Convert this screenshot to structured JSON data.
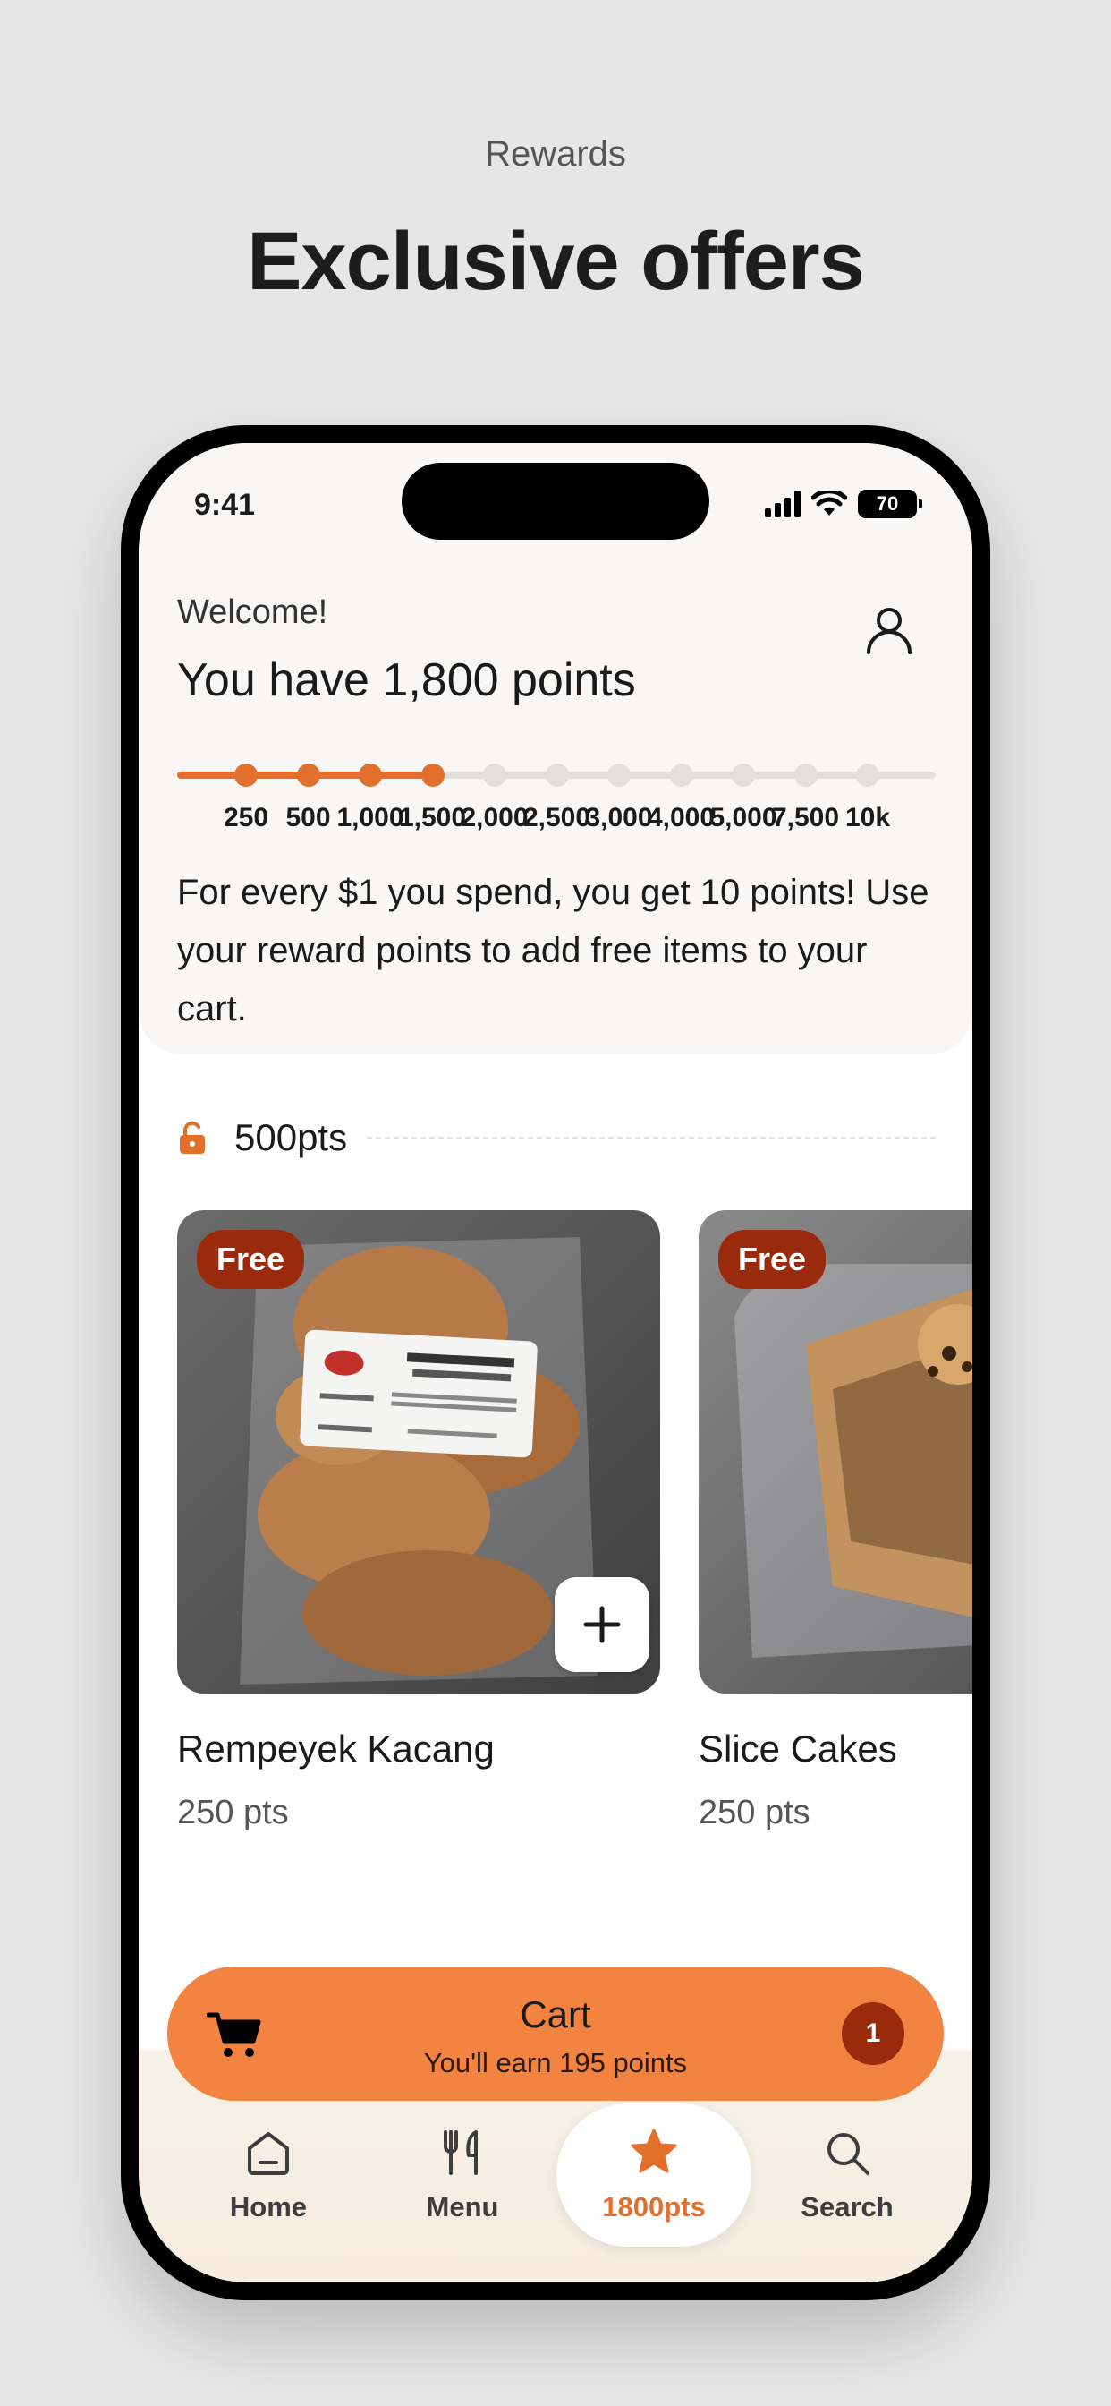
{
  "page": {
    "eyebrow": "Rewards",
    "title": "Exclusive offers"
  },
  "status_bar": {
    "time": "9:41",
    "battery": "70"
  },
  "header": {
    "welcome": "Welcome!",
    "points_headline": "You have 1,800 points",
    "info_text": "For every $1 you spend, you get 10 points! Use your reward points to add free items to your cart."
  },
  "progress": {
    "current_points": 1800,
    "milestones": [
      "250",
      "500",
      "1,000",
      "1,500",
      "2,000",
      "2,500",
      "3,000",
      "4,000",
      "5,000",
      "7,500",
      "10k"
    ],
    "reached_count": 4
  },
  "tier": {
    "label": "500pts",
    "icon": "lock-open-icon"
  },
  "products": [
    {
      "name": "Rempeyek Kacang",
      "points": "250 pts",
      "badge": "Free"
    },
    {
      "name": "Slice Cakes",
      "points": "250 pts",
      "badge": "Free"
    }
  ],
  "cart": {
    "title": "Cart",
    "subtitle": "You'll earn 195 points",
    "count": "1"
  },
  "nav": {
    "items": [
      {
        "label": "Home",
        "icon": "home-icon"
      },
      {
        "label": "Menu",
        "icon": "utensils-icon"
      },
      {
        "label": "1800pts",
        "icon": "star-icon"
      },
      {
        "label": "Search",
        "icon": "search-icon"
      }
    ],
    "active_index": 2
  },
  "colors": {
    "accent": "#e36f2c",
    "cart": "#f28340",
    "badge": "#9a2a0c"
  }
}
